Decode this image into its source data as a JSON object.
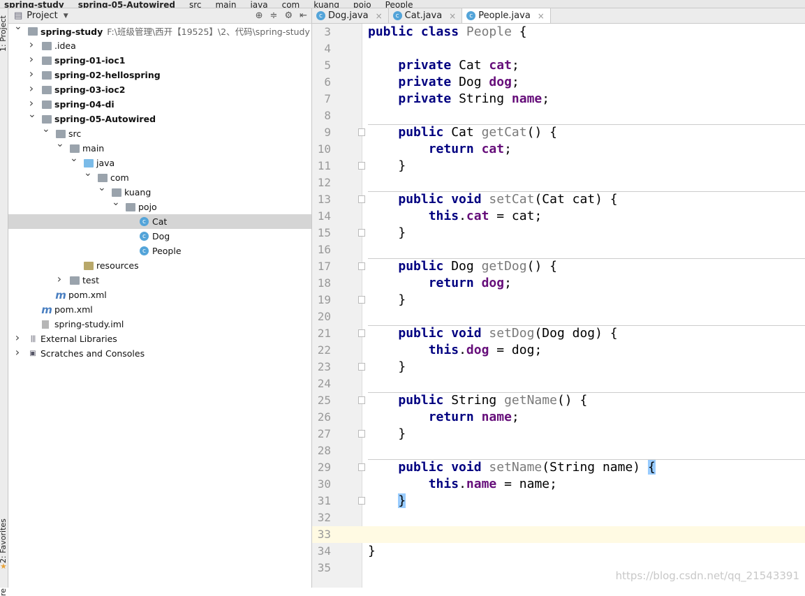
{
  "breadcrumb": [
    "spring-study",
    "spring-05-Autowired",
    "src",
    "main",
    "java",
    "com",
    "kuang",
    "pojo",
    "People"
  ],
  "side_tabs": {
    "project": "1: Project",
    "favorites": "2: Favorites",
    "structure": "re"
  },
  "project": {
    "title": "Project",
    "tree": [
      {
        "label": "spring-study",
        "depth": 0,
        "arrow": "down",
        "icon": "folder",
        "bold": true,
        "path": "F:\\班级管理\\西开【19525】\\2、代码\\spring-study"
      },
      {
        "label": ".idea",
        "depth": 1,
        "arrow": "right",
        "icon": "folder"
      },
      {
        "label": "spring-01-ioc1",
        "depth": 1,
        "arrow": "right",
        "icon": "folder",
        "bold": true
      },
      {
        "label": "spring-02-hellospring",
        "depth": 1,
        "arrow": "right",
        "icon": "folder",
        "bold": true
      },
      {
        "label": "spring-03-ioc2",
        "depth": 1,
        "arrow": "right",
        "icon": "folder",
        "bold": true
      },
      {
        "label": "spring-04-di",
        "depth": 1,
        "arrow": "right",
        "icon": "folder",
        "bold": true
      },
      {
        "label": "spring-05-Autowired",
        "depth": 1,
        "arrow": "down",
        "icon": "folder",
        "bold": true
      },
      {
        "label": "src",
        "depth": 2,
        "arrow": "down",
        "icon": "folder"
      },
      {
        "label": "main",
        "depth": 3,
        "arrow": "down",
        "icon": "folder"
      },
      {
        "label": "java",
        "depth": 4,
        "arrow": "down",
        "icon": "folder-blue"
      },
      {
        "label": "com",
        "depth": 5,
        "arrow": "down",
        "icon": "package"
      },
      {
        "label": "kuang",
        "depth": 6,
        "arrow": "down",
        "icon": "package"
      },
      {
        "label": "pojo",
        "depth": 7,
        "arrow": "down",
        "icon": "package"
      },
      {
        "label": "Cat",
        "depth": 8,
        "icon": "class",
        "selected": true
      },
      {
        "label": "Dog",
        "depth": 8,
        "icon": "class"
      },
      {
        "label": "People",
        "depth": 8,
        "icon": "class"
      },
      {
        "label": "resources",
        "depth": 4,
        "icon": "resources-folder"
      },
      {
        "label": "test",
        "depth": 3,
        "arrow": "right",
        "icon": "folder"
      },
      {
        "label": "pom.xml",
        "depth": 2,
        "icon": "maven"
      },
      {
        "label": "pom.xml",
        "depth": 1,
        "icon": "maven"
      },
      {
        "label": "spring-study.iml",
        "depth": 1,
        "icon": "iml-file"
      },
      {
        "label": "External Libraries",
        "depth": 0,
        "arrow": "right",
        "icon": "libraries"
      },
      {
        "label": "Scratches and Consoles",
        "depth": 0,
        "arrow": "right",
        "icon": "scratches"
      }
    ]
  },
  "tabs": [
    {
      "label": "Dog.java"
    },
    {
      "label": "Cat.java"
    },
    {
      "label": "People.java",
      "active": true
    }
  ],
  "code": [
    {
      "n": "3",
      "t": [
        [
          "k",
          "public class "
        ],
        [
          "m",
          "People"
        ],
        [
          "p",
          " {"
        ]
      ]
    },
    {
      "n": "4",
      "t": []
    },
    {
      "n": "5",
      "t": [
        [
          "p",
          "    "
        ],
        [
          "k",
          "private "
        ],
        [
          "p",
          "Cat "
        ],
        [
          "f",
          "cat"
        ],
        [
          "p",
          ";"
        ]
      ]
    },
    {
      "n": "6",
      "t": [
        [
          "p",
          "    "
        ],
        [
          "k",
          "private "
        ],
        [
          "p",
          "Dog "
        ],
        [
          "f",
          "dog"
        ],
        [
          "p",
          ";"
        ]
      ]
    },
    {
      "n": "7",
      "t": [
        [
          "p",
          "    "
        ],
        [
          "k",
          "private "
        ],
        [
          "p",
          "String "
        ],
        [
          "f",
          "name"
        ],
        [
          "p",
          ";"
        ]
      ]
    },
    {
      "n": "8",
      "t": []
    },
    {
      "n": "9",
      "sep": true,
      "fold": true,
      "t": [
        [
          "p",
          "    "
        ],
        [
          "k",
          "public "
        ],
        [
          "p",
          "Cat "
        ],
        [
          "m",
          "getCat"
        ],
        [
          "p",
          "() {"
        ]
      ]
    },
    {
      "n": "10",
      "t": [
        [
          "p",
          "        "
        ],
        [
          "k",
          "return "
        ],
        [
          "f",
          "cat"
        ],
        [
          "p",
          ";"
        ]
      ]
    },
    {
      "n": "11",
      "fold": true,
      "t": [
        [
          "p",
          "    }"
        ]
      ]
    },
    {
      "n": "12",
      "t": []
    },
    {
      "n": "13",
      "sep": true,
      "fold": true,
      "t": [
        [
          "p",
          "    "
        ],
        [
          "k",
          "public void "
        ],
        [
          "m",
          "setCat"
        ],
        [
          "p",
          "(Cat cat) {"
        ]
      ]
    },
    {
      "n": "14",
      "t": [
        [
          "p",
          "        "
        ],
        [
          "k",
          "this"
        ],
        [
          "p",
          "."
        ],
        [
          "f",
          "cat"
        ],
        [
          "p",
          " = cat;"
        ]
      ]
    },
    {
      "n": "15",
      "fold": true,
      "t": [
        [
          "p",
          "    }"
        ]
      ]
    },
    {
      "n": "16",
      "t": []
    },
    {
      "n": "17",
      "sep": true,
      "fold": true,
      "t": [
        [
          "p",
          "    "
        ],
        [
          "k",
          "public "
        ],
        [
          "p",
          "Dog "
        ],
        [
          "m",
          "getDog"
        ],
        [
          "p",
          "() {"
        ]
      ]
    },
    {
      "n": "18",
      "t": [
        [
          "p",
          "        "
        ],
        [
          "k",
          "return "
        ],
        [
          "f",
          "dog"
        ],
        [
          "p",
          ";"
        ]
      ]
    },
    {
      "n": "19",
      "fold": true,
      "t": [
        [
          "p",
          "    }"
        ]
      ]
    },
    {
      "n": "20",
      "t": []
    },
    {
      "n": "21",
      "sep": true,
      "fold": true,
      "t": [
        [
          "p",
          "    "
        ],
        [
          "k",
          "public void "
        ],
        [
          "m",
          "setDog"
        ],
        [
          "p",
          "(Dog dog) {"
        ]
      ]
    },
    {
      "n": "22",
      "t": [
        [
          "p",
          "        "
        ],
        [
          "k",
          "this"
        ],
        [
          "p",
          "."
        ],
        [
          "f",
          "dog"
        ],
        [
          "p",
          " = dog;"
        ]
      ]
    },
    {
      "n": "23",
      "fold": true,
      "t": [
        [
          "p",
          "    }"
        ]
      ]
    },
    {
      "n": "24",
      "t": []
    },
    {
      "n": "25",
      "sep": true,
      "fold": true,
      "t": [
        [
          "p",
          "    "
        ],
        [
          "k",
          "public "
        ],
        [
          "p",
          "String "
        ],
        [
          "m",
          "getName"
        ],
        [
          "p",
          "() {"
        ]
      ]
    },
    {
      "n": "26",
      "t": [
        [
          "p",
          "        "
        ],
        [
          "k",
          "return "
        ],
        [
          "f",
          "name"
        ],
        [
          "p",
          ";"
        ]
      ]
    },
    {
      "n": "27",
      "fold": true,
      "t": [
        [
          "p",
          "    }"
        ]
      ]
    },
    {
      "n": "28",
      "t": []
    },
    {
      "n": "29",
      "sep": true,
      "fold": true,
      "t": [
        [
          "p",
          "    "
        ],
        [
          "k",
          "public void "
        ],
        [
          "m",
          "setName"
        ],
        [
          "p",
          "(String name) "
        ],
        [
          "hl",
          "{"
        ]
      ]
    },
    {
      "n": "30",
      "t": [
        [
          "p",
          "        "
        ],
        [
          "k",
          "this"
        ],
        [
          "p",
          "."
        ],
        [
          "f",
          "name"
        ],
        [
          "p",
          " = name;"
        ]
      ]
    },
    {
      "n": "31",
      "fold": true,
      "t": [
        [
          "p",
          "    "
        ],
        [
          "hl",
          "}"
        ]
      ]
    },
    {
      "n": "32",
      "t": []
    },
    {
      "n": "33",
      "current": true,
      "t": []
    },
    {
      "n": "34",
      "t": [
        [
          "p",
          "}"
        ]
      ]
    },
    {
      "n": "35",
      "t": []
    }
  ],
  "watermark": "https://blog.csdn.net/qq_21543391",
  "colors": {
    "keyword": "#000080",
    "field": "#660e7a",
    "unused": "#7a7a7a",
    "current_line": "#fffae3",
    "brace_match": "#99ccff"
  }
}
